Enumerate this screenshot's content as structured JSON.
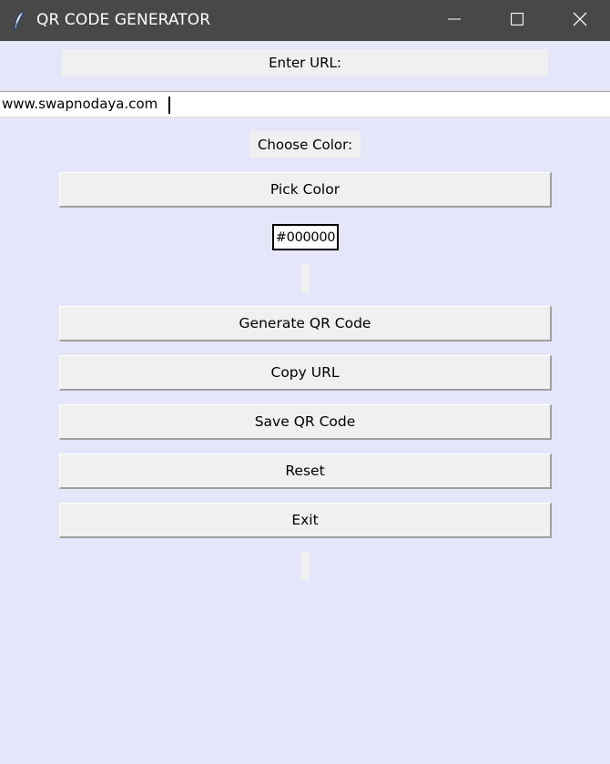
{
  "window": {
    "title": "QR CODE GENERATOR",
    "icon": "feather-icon",
    "controls": [
      "minimize-icon",
      "maximize-icon",
      "close-icon"
    ]
  },
  "form": {
    "url_label": "Enter URL:",
    "url_value": "www.swapnodaya.com",
    "color_label": "Choose Color:",
    "pick_color_label": "Pick Color",
    "color_value": "#000000"
  },
  "actions": {
    "generate_label": "Generate QR Code",
    "copy_label": "Copy URL",
    "save_label": "Save QR Code",
    "reset_label": "Reset",
    "exit_label": "Exit"
  },
  "colors": {
    "background": "#e6e6fa",
    "titlebar": "#484848",
    "button": "#f0f0f0"
  }
}
